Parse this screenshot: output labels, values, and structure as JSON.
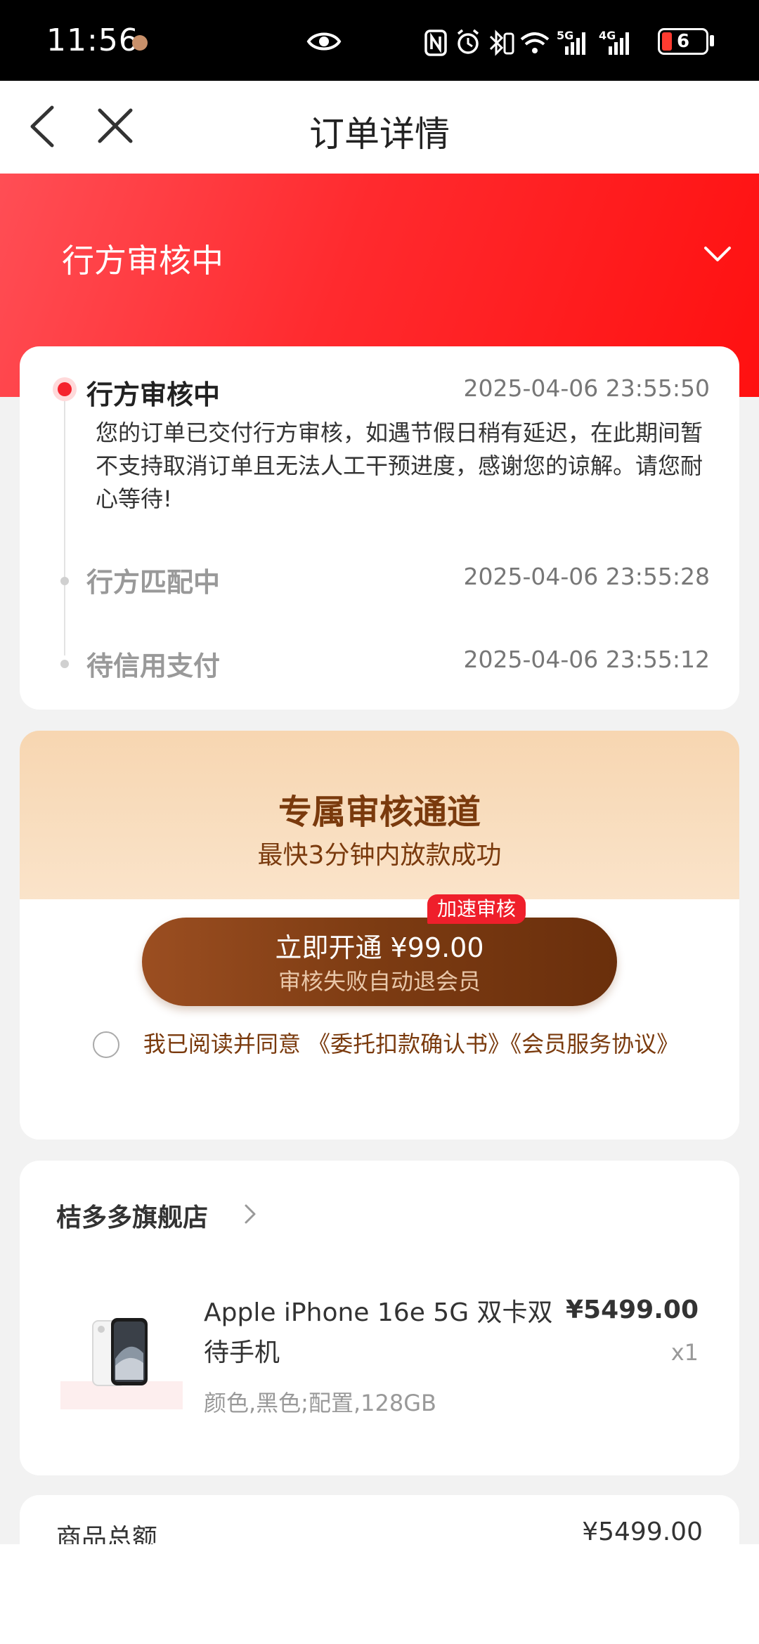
{
  "status_bar": {
    "time": "11:56",
    "battery": "6",
    "net_5g": "5G",
    "net_4g": "4G"
  },
  "nav": {
    "title": "订单详情"
  },
  "banner": {
    "status": "行方审核中"
  },
  "timeline": {
    "steps": [
      {
        "title": "行方审核中",
        "time": "2025-04-06 23:55:50",
        "desc": "您的订单已交付行方审核，如遇节假日稍有延迟，在此期间暂不支持取消订单且无法人工干预进度，感谢您的谅解。请您耐心等待!"
      },
      {
        "title": "行方匹配中",
        "time": "2025-04-06 23:55:28"
      },
      {
        "title": "待信用支付",
        "time": "2025-04-06 23:55:12"
      }
    ]
  },
  "membership": {
    "title": "专属审核通道",
    "subtitle": "最快3分钟内放款成功",
    "badge": "加速审核",
    "button_main": "立即开通 ¥99.00",
    "button_sub": "审核失败自动退会员",
    "agreement": "我已阅读并同意 《委托扣款确认书》《会员服务协议》"
  },
  "store": {
    "name": "桔多多旗舰店",
    "product": {
      "name": "Apple iPhone 16e 5G 双卡双待手机",
      "price": "¥5499.00",
      "qty": "x1",
      "spec": "颜色,黑色;配置,128GB"
    }
  },
  "summary": {
    "label": "商品总额",
    "value": "¥5499.00"
  },
  "colors": {
    "accent_red": "#f5222d",
    "banner_red": "#ff2a2e",
    "brown": "#7a3a0d"
  }
}
